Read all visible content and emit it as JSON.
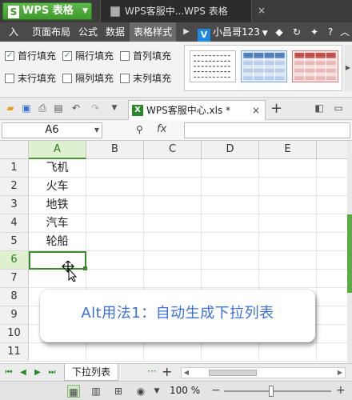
{
  "titlebar": {
    "app_name": "WPS 表格",
    "app_logo": "S",
    "window_title": "WPS客服中...WPS 表格"
  },
  "menubar": {
    "items": [
      "入",
      "页面布局",
      "公式",
      "数据",
      "表格样式"
    ],
    "active": "表格样式",
    "user_name": "小昌哥123",
    "user_badge": "V"
  },
  "ribbon": {
    "checkboxes": [
      {
        "label": "首行填充",
        "checked": true
      },
      {
        "label": "隔行填充",
        "checked": true
      },
      {
        "label": "首列填充",
        "checked": false
      },
      {
        "label": "末行填充",
        "checked": false
      },
      {
        "label": "隔列填充",
        "checked": false
      },
      {
        "label": "末列填充",
        "checked": false
      }
    ],
    "styles": [
      "plain-dashed",
      "blue-banded",
      "red-banded"
    ]
  },
  "doc_tab": {
    "filename": "WPS客服中心.xls *",
    "file_icon_letter": "X"
  },
  "formula_bar": {
    "name_box": "A6",
    "fx_label": "fx",
    "formula": ""
  },
  "sheet": {
    "columns": [
      "A",
      "B",
      "C",
      "D",
      "E"
    ],
    "selected_column": "A",
    "rows": [
      "1",
      "2",
      "3",
      "4",
      "5",
      "6",
      "7",
      "8",
      "9",
      "10",
      "11"
    ],
    "selected_row": "6",
    "column_a_values": [
      "飞机",
      "火车",
      "地铁",
      "汽车",
      "轮船",
      "",
      "",
      "",
      "",
      "",
      ""
    ]
  },
  "annotation": {
    "text": "Alt用法1：自动生成下拉列表",
    "color": "#3a6fd8"
  },
  "sheet_tabs": {
    "active_tab": "下拉列表",
    "more": "···",
    "add": "+"
  },
  "statusbar": {
    "zoom_label": "100 %",
    "zoom_value": 100,
    "minus": "−",
    "plus": "+"
  },
  "colors": {
    "accent_green": "#3a8a2a",
    "titlebar": "#3c3c3c"
  }
}
